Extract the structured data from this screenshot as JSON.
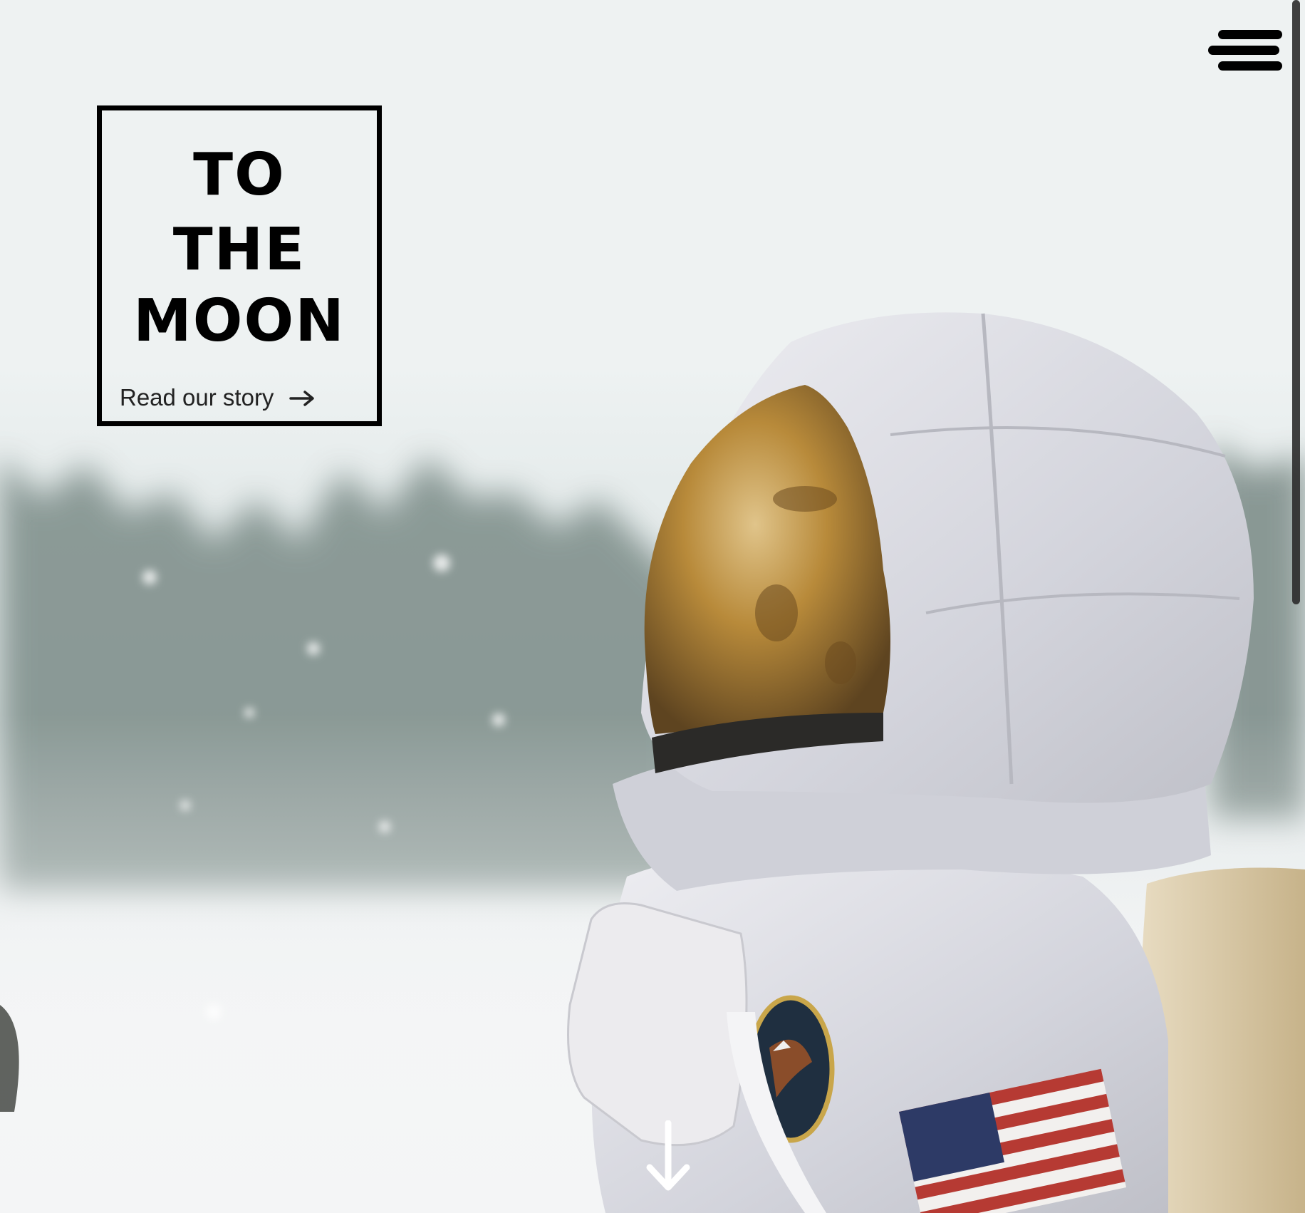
{
  "hero": {
    "image_description_icon": "astronaut-photo"
  },
  "header": {
    "menu_icon": "hamburger-menu-icon"
  },
  "title_card": {
    "lines": [
      "TO",
      "THE",
      "MOON"
    ],
    "link_label": "Read our story",
    "link_icon": "arrow-right-icon"
  },
  "scroll_hint": {
    "icon": "arrow-down-icon"
  },
  "colors": {
    "text": "#000000",
    "link": "#222222",
    "sky": "#eef2f2",
    "visor_gold": "#b88a3a",
    "suit_white": "#dcdde3"
  }
}
